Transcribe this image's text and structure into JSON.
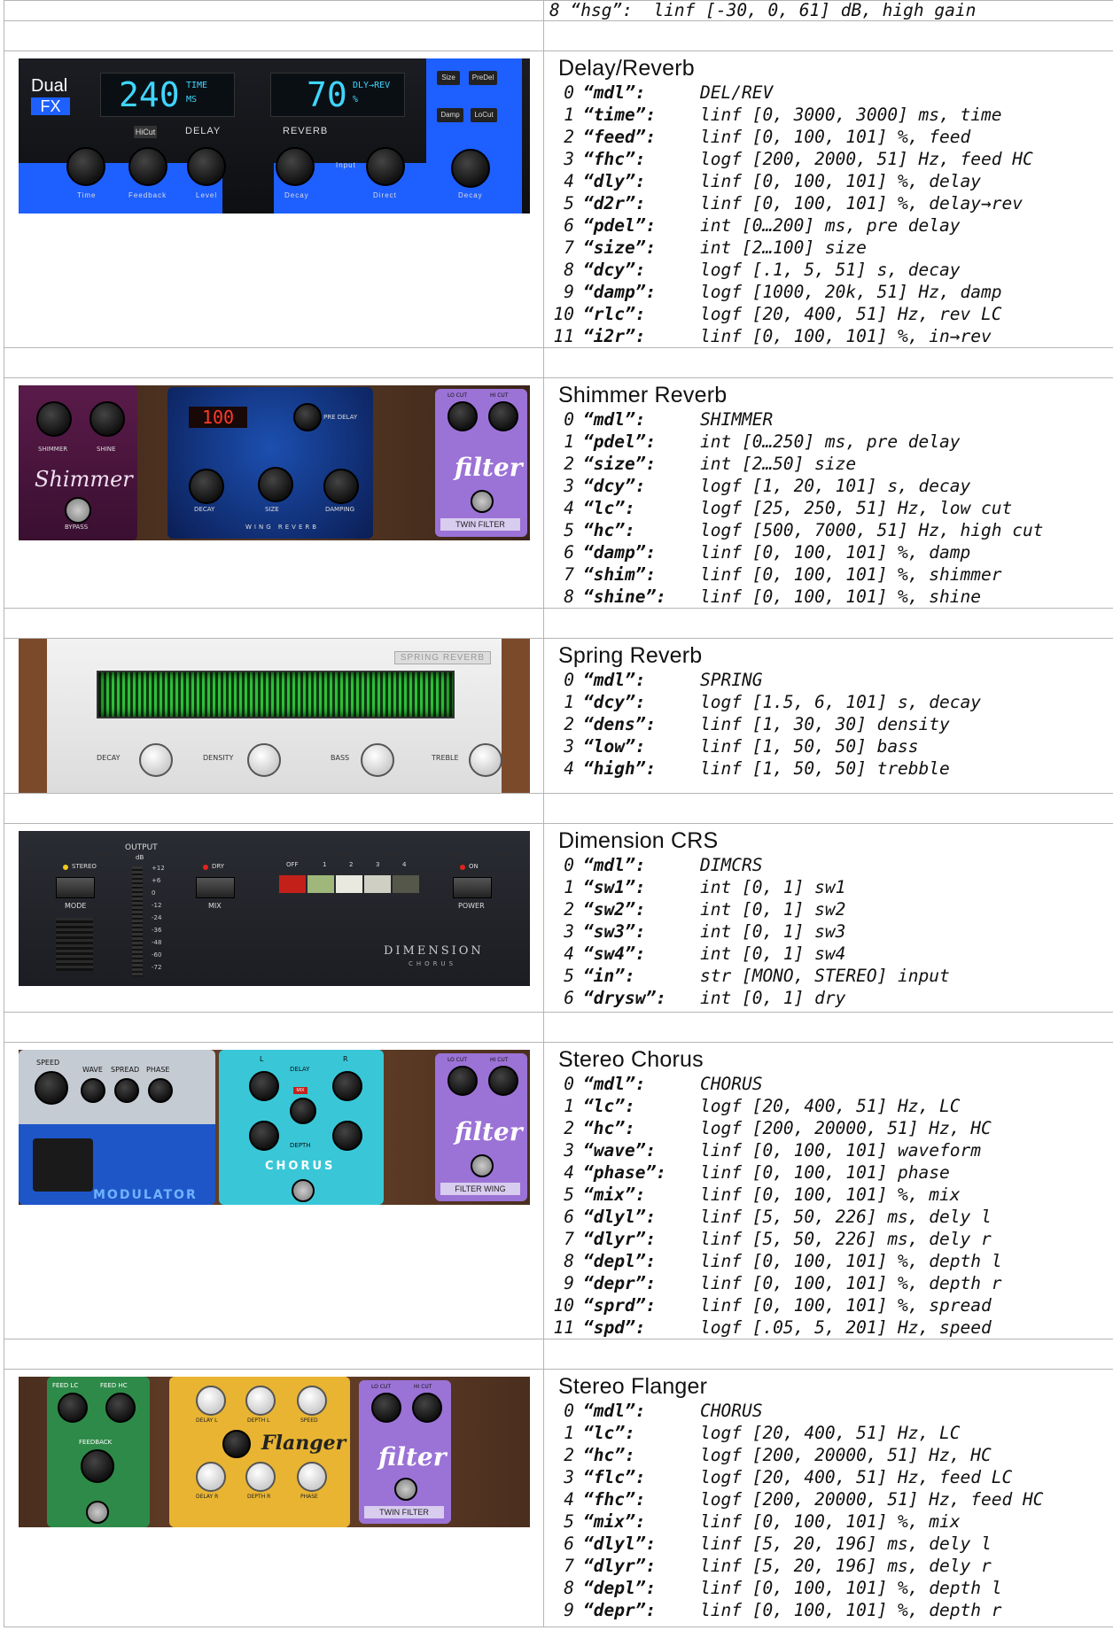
{
  "top_row": {
    "text": "8 “hsg”:  linf [-30, 0, 61] dB, high gain"
  },
  "sections": [
    {
      "id": "delay-reverb",
      "title": "Delay/Reverb",
      "params": [
        [
          "0",
          "“mdl”:",
          "DEL/REV"
        ],
        [
          "1",
          "“time”:",
          "linf [0, 3000, 3000] ms, time"
        ],
        [
          "2",
          "“feed”:",
          "linf [0, 100, 101] %, feed"
        ],
        [
          "3",
          "“fhc”:",
          "logf [200, 2000, 51] Hz, feed HC"
        ],
        [
          "4",
          "“dly”:",
          "linf [0, 100, 101] %, delay"
        ],
        [
          "5",
          "“d2r”:",
          "linf [0, 100, 101] %, delay→rev"
        ],
        [
          "6",
          "“pdel”:",
          "int [0…200] ms, pre delay"
        ],
        [
          "7",
          "“size”:",
          "int [2…100] size"
        ],
        [
          "8",
          "“dcy”:",
          "logf [.1, 5, 51] s, decay"
        ],
        [
          "9",
          "“damp”:",
          "logf [1000, 20k, 51] Hz, damp"
        ],
        [
          "10",
          "“rlc”:",
          "logf [20, 400, 51] Hz, rev LC"
        ],
        [
          "11",
          "“i2r”:",
          "linf [0, 100, 101] %, in→rev"
        ]
      ]
    },
    {
      "id": "shimmer-reverb",
      "title": "Shimmer Reverb",
      "params": [
        [
          "0",
          "“mdl”:",
          "SHIMMER"
        ],
        [
          "1",
          "“pdel”:",
          "int [0…250] ms, pre delay"
        ],
        [
          "2",
          "“size”:",
          "int [2…50] size"
        ],
        [
          "3",
          "“dcy”:",
          "logf [1, 20, 101] s, decay"
        ],
        [
          "4",
          "“lc”:",
          "logf [25, 250, 51] Hz, low cut"
        ],
        [
          "5",
          "“hc”:",
          "logf [500, 7000, 51] Hz, high cut"
        ],
        [
          "6",
          "“damp”:",
          "linf [0, 100, 101] %, damp"
        ],
        [
          "7",
          "“shim”:",
          "linf [0, 100, 101] %, shimmer"
        ],
        [
          "8",
          "“shine”:",
          "linf [0, 100, 101] %, shine"
        ]
      ]
    },
    {
      "id": "spring-reverb",
      "title": "Spring Reverb",
      "params": [
        [
          "0",
          "“mdl”:",
          "SPRING"
        ],
        [
          "1",
          "“dcy”:",
          "logf [1.5, 6, 101] s, decay"
        ],
        [
          "2",
          "“dens”:",
          "linf [1, 30, 30] density"
        ],
        [
          "3",
          "“low”:",
          "linf [1, 50, 50] bass"
        ],
        [
          "4",
          "“high”:",
          "linf [1, 50, 50] trebble"
        ]
      ]
    },
    {
      "id": "dimension-crs",
      "title": "Dimension CRS",
      "params": [
        [
          "0",
          "“mdl”:",
          "DIMCRS"
        ],
        [
          "1",
          "“sw1”:",
          "int [0, 1] sw1"
        ],
        [
          "2",
          "“sw2”:",
          "int [0, 1] sw2"
        ],
        [
          "3",
          "“sw3”:",
          "int [0, 1] sw3"
        ],
        [
          "4",
          "“sw4”:",
          "int [0, 1] sw4"
        ],
        [
          "5",
          "“in”:",
          "str [MONO, STEREO] input"
        ],
        [
          "6",
          "“drysw”:",
          "int [0, 1] dry"
        ]
      ]
    },
    {
      "id": "stereo-chorus",
      "title": "Stereo Chorus",
      "params": [
        [
          "0",
          "“mdl”:",
          "CHORUS"
        ],
        [
          "1",
          "“lc”:",
          "logf [20, 400, 51] Hz, LC"
        ],
        [
          "2",
          "“hc”:",
          "logf [200, 20000, 51] Hz, HC"
        ],
        [
          "3",
          "“wave”:",
          "linf [0, 100, 101] waveform"
        ],
        [
          "4",
          "“phase”:",
          "linf [0, 100, 101] phase"
        ],
        [
          "5",
          "“mix”:",
          "linf [0, 100, 101] %, mix"
        ],
        [
          "6",
          "“dlyl”:",
          "linf [5, 50, 226] ms, dely l"
        ],
        [
          "7",
          "“dlyr”:",
          "linf [5, 50, 226] ms, dely r"
        ],
        [
          "8",
          "“depl”:",
          "linf [0, 100, 101] %, depth l"
        ],
        [
          "9",
          "“depr”:",
          "linf [0, 100, 101] %, depth r"
        ],
        [
          "10",
          "“sprd”:",
          "linf [0, 100, 101] %, spread"
        ],
        [
          "11",
          "“spd”:",
          "logf [.05, 5, 201] Hz, speed"
        ]
      ]
    },
    {
      "id": "stereo-flanger",
      "title": "Stereo Flanger",
      "params": [
        [
          "0",
          "“mdl”:",
          "CHORUS"
        ],
        [
          "1",
          "“lc”:",
          "logf [20, 400, 51] Hz, LC"
        ],
        [
          "2",
          "“hc”:",
          "logf [200, 20000, 51] Hz, HC"
        ],
        [
          "3",
          "“flc”:",
          "logf [20, 400, 51] Hz, feed LC"
        ],
        [
          "4",
          "“fhc”:",
          "logf [200, 20000, 51] Hz, feed HC"
        ],
        [
          "5",
          "“mix”:",
          "linf [0, 100, 101] %, mix"
        ],
        [
          "6",
          "“dlyl”:",
          "linf [5, 20, 196] ms, dely l"
        ],
        [
          "7",
          "“dlyr”:",
          "linf [5, 20, 196] ms, dely r"
        ],
        [
          "8",
          "“depl”:",
          "linf [0, 100, 101] %, depth l"
        ],
        [
          "9",
          "“depr”:",
          "linf [0, 100, 101] %, depth r"
        ]
      ]
    }
  ],
  "panels": {
    "dualfx": {
      "brand1": "Dual",
      "brand2": "FX",
      "lcd1": "240",
      "lcd1_unit1": "TIME",
      "lcd1_unit2": "MS",
      "lcd2": "70",
      "lcd2_unit1": "DLY→REV",
      "lcd2_unit2": "%",
      "delay": "DELAY",
      "reverb": "REVERB",
      "hicut": "HiCut",
      "btn_size": "Size",
      "btn_predel": "PreDel",
      "btn_damp": "Damp",
      "btn_locut": "LoCut",
      "k_time": "Time",
      "k_feedback": "Feedback",
      "k_level": "Level",
      "k_decay": "Decay",
      "k_input": "Input",
      "k_direct": "Direct",
      "k_decay2": "Decay"
    },
    "shimmer": {
      "lcd": "100",
      "pre_delay": "PRE DELAY",
      "decay": "DECAY",
      "size": "SIZE",
      "damping": "DAMPING",
      "wing": "WING REVERB",
      "shimmer": "Shimmer",
      "shim_lbl": "SHIMMER",
      "shine_lbl": "SHINE",
      "bypass": "BYPASS",
      "locut": "LO CUT",
      "hicut": "HI CUT",
      "filter": "filter",
      "twin": "TWIN FILTER"
    },
    "spring": {
      "badge": "SPRING REVERB",
      "decay": "DECAY",
      "density": "DENSITY",
      "bass": "BASS",
      "treble": "TREBLE"
    },
    "dim": {
      "output": "OUTPUT",
      "db": "dB",
      "stereo": "STEREO",
      "mode": "MODE",
      "dry": "DRY",
      "mix": "MIX",
      "off": "OFF",
      "s1": "1",
      "s2": "2",
      "s3": "3",
      "s4": "4",
      "on": "ON",
      "power": "POWER",
      "brand": "DIMENSION",
      "brand2": "CHORUS",
      "meter": [
        "+12",
        "+6",
        "0",
        "-12",
        "-24",
        "-36",
        "-48",
        "-60",
        "-72"
      ]
    },
    "chorus": {
      "speed": "SPEED",
      "wave": "WAVE",
      "spread": "SPREAD",
      "phase": "PHASE",
      "modulator": "MODULATOR",
      "l": "L",
      "r": "R",
      "delay": "DELAY",
      "depth": "DEPTH",
      "mix": "MIX",
      "chorus": "CHORUS",
      "locut": "LO CUT",
      "hicut": "HI CUT",
      "filter": "filter",
      "wing": "FILTER WING"
    },
    "flanger": {
      "feedlc": "FEED LC",
      "feedhc": "FEED HC",
      "feedback": "FEEDBACK",
      "delayl": "DELAY L",
      "depthl": "DEPTH L",
      "speed": "SPEED",
      "flanger": "Flanger",
      "delayr": "DELAY R",
      "depthr": "DEPTH R",
      "phase": "PHASE",
      "locut": "LO CUT",
      "hicut": "HI CUT",
      "filter": "filter",
      "twin": "TWIN FILTER"
    }
  }
}
